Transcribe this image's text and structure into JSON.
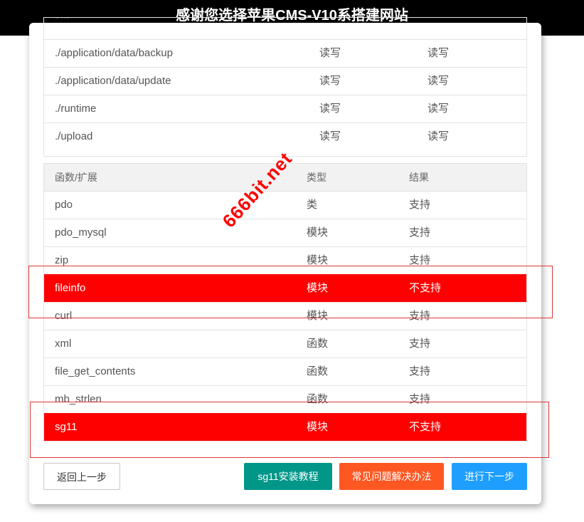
{
  "header": {
    "title": "感谢您选择苹果CMS-V10系搭建网站"
  },
  "directories": {
    "rows": [
      {
        "path": "./...",
        "c2": "",
        "c3": ""
      },
      {
        "path": "./application/data/backup",
        "c2": "读写",
        "c3": "读写"
      },
      {
        "path": "./application/data/update",
        "c2": "读写",
        "c3": "读写"
      },
      {
        "path": "./runtime",
        "c2": "读写",
        "c3": "读写"
      },
      {
        "path": "./upload",
        "c2": "读写",
        "c3": "读写"
      }
    ]
  },
  "extensions": {
    "headers": [
      "函数/扩展",
      "类型",
      "结果"
    ],
    "rows": [
      {
        "name": "pdo",
        "type": "类",
        "result": "支持"
      },
      {
        "name": "pdo_mysql",
        "type": "模块",
        "result": "支持"
      },
      {
        "name": "zip",
        "type": "模块",
        "result": "支持"
      },
      {
        "name": "fileinfo",
        "type": "模块",
        "result": "不支持"
      },
      {
        "name": "curl",
        "type": "模块",
        "result": "支持"
      },
      {
        "name": "xml",
        "type": "函数",
        "result": "支持"
      },
      {
        "name": "file_get_contents",
        "type": "函数",
        "result": "支持"
      },
      {
        "name": "mb_strlen",
        "type": "函数",
        "result": "支持"
      },
      {
        "name": "sg11",
        "type": "模块",
        "result": "不支持"
      }
    ]
  },
  "watermark": "666bit.net",
  "buttons": {
    "back": "返回上一步",
    "sg11": "sg11安装教程",
    "faq": "常见问题解决办法",
    "next": "进行下一步"
  },
  "colors": {
    "header_bg": "#000000",
    "fail_row": "#ff0000",
    "highlight_box": "#e03535",
    "sg11_button": "#009688",
    "faq_button": "#ff5722",
    "next_button": "#1e9fff"
  }
}
